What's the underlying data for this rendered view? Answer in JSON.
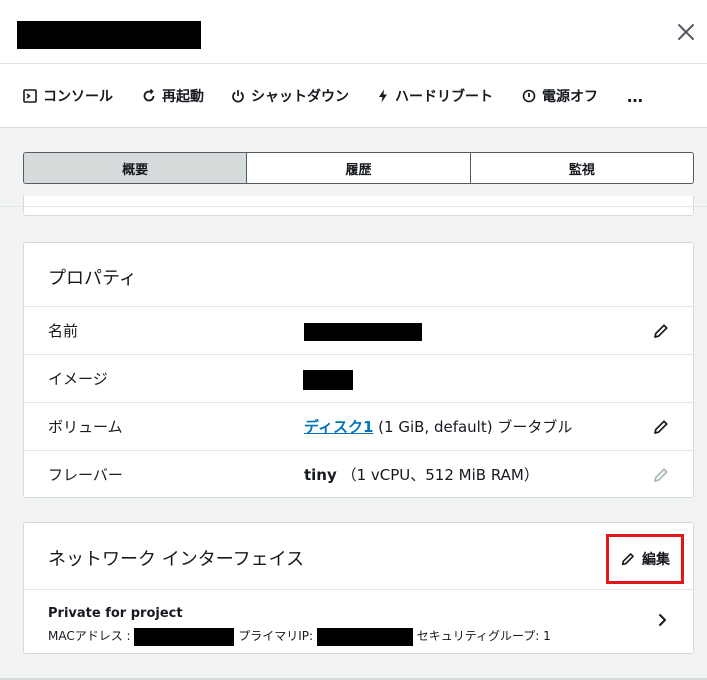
{
  "toolbar": {
    "console": "コンソール",
    "restart": "再起動",
    "shutdown": "シャットダウン",
    "hard_reboot": "ハードリブート",
    "power_off": "電源オフ",
    "more": "…"
  },
  "tabs": [
    {
      "label": "概要",
      "active": true
    },
    {
      "label": "履歴",
      "active": false
    },
    {
      "label": "監視",
      "active": false
    }
  ],
  "properties": {
    "title": "プロパティ",
    "name_label": "名前",
    "image_label": "イメージ",
    "volume_label": "ボリューム",
    "volume_link": "ディスク1",
    "volume_rest": "(1 GiB, default) ブータブル",
    "flavor_label": "フレーバー",
    "flavor_name": "tiny",
    "flavor_detail": "（1 vCPU、512 MiB RAM）"
  },
  "network": {
    "title": "ネットワーク インターフェイス",
    "edit_label": "編集",
    "item_name": "Private for project",
    "mac_label": "MACアドレス :",
    "ip_label": "プライマリIP:",
    "sg_label": "セキュリティグループ: 1"
  },
  "colors": {
    "link": "#0073bb",
    "highlight_border": "#e0161b",
    "active_tab": "#d5dbdb"
  }
}
